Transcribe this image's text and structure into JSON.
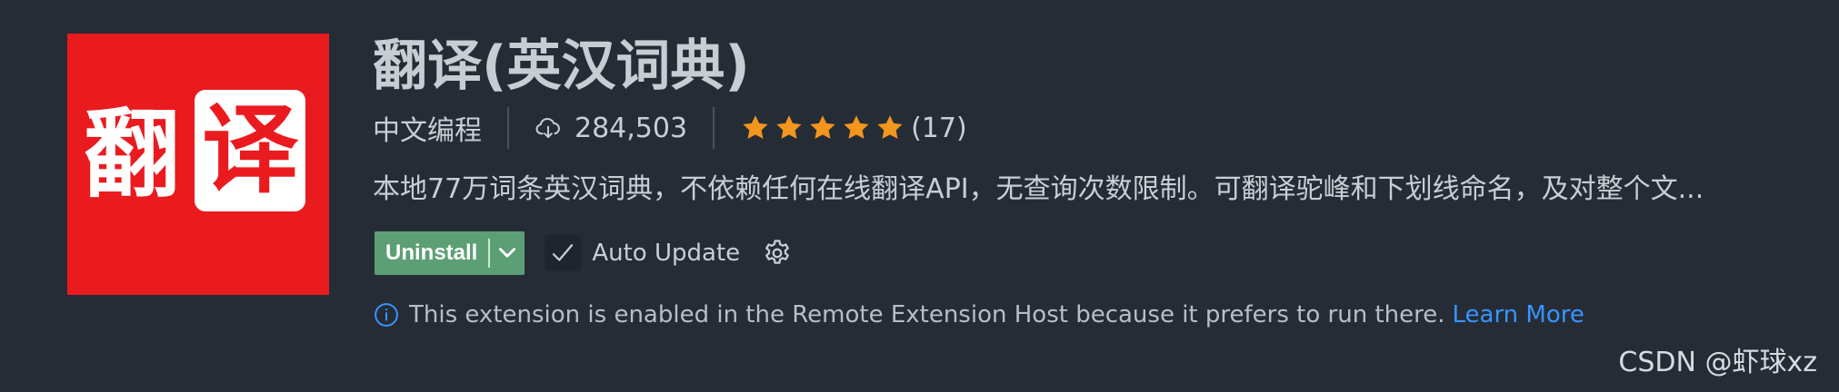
{
  "extension": {
    "title": "翻译(英汉词典)",
    "publisher": "中文编程",
    "installs": "284,503",
    "rating_stars": 5,
    "rating_count": "(17)",
    "description": "本地77万词条英汉词典，不依赖任何在线翻译API，无查询次数限制。可翻译驼峰和下划线命名，及对整个文...",
    "logo_text": "翻译"
  },
  "actions": {
    "uninstall_label": "Uninstall",
    "auto_update_label": "Auto Update"
  },
  "info": {
    "message": "This extension is enabled in the Remote Extension Host because it prefers to run there.",
    "link_label": "Learn More"
  },
  "watermark": "CSDN @虾球xz",
  "colors": {
    "background": "#262c36",
    "logo_red": "#ea1b1f",
    "star": "#f2961d",
    "uninstall_bg": "#5d9f74",
    "link": "#3794ff"
  }
}
